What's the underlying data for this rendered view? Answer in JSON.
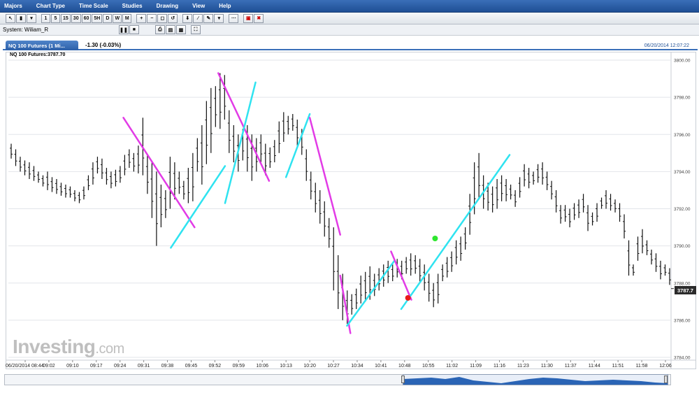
{
  "menu": [
    "Majors",
    "Chart Type",
    "Time Scale",
    "Studies",
    "Drawing",
    "View",
    "Help"
  ],
  "toolbar": {
    "intervals": [
      "1",
      "5",
      "15",
      "30",
      "60",
      "5H",
      "D",
      "W",
      "M"
    ]
  },
  "system": {
    "label": "System:",
    "value": "Wiliam_R"
  },
  "tab": {
    "label": "NQ 100 Futures (1 Mi...",
    "change": "-1.30 (-0.03%)",
    "datetime": "06/20/2014 12:07:22"
  },
  "chart_data": {
    "type": "ohlc-bar",
    "symbol_label": "NQ 100 Futures:3787.70",
    "last_price": "3787.7",
    "y_ticks": [
      "3800.00",
      "3798.00",
      "3796.00",
      "3794.00",
      "3792.00",
      "3790.00",
      "3788.00",
      "3786.00",
      "3784.00"
    ],
    "x_ticks": [
      "06/20/2014 08:44",
      "09:02",
      "09:10",
      "09:17",
      "09:24",
      "09:31",
      "09:38",
      "09:45",
      "09:52",
      "09:59",
      "10:06",
      "10:13",
      "10:20",
      "10:27",
      "10:34",
      "10:41",
      "10:48",
      "10:55",
      "11:02",
      "11:09",
      "11:16",
      "11:23",
      "11:30",
      "11:37",
      "11:44",
      "11:51",
      "11:58",
      "12:06"
    ],
    "ylim": [
      3784,
      3800
    ],
    "bars": [
      [
        3795.5,
        3794.7
      ],
      [
        3795.2,
        3794.3
      ],
      [
        3794.8,
        3794.0
      ],
      [
        3794.6,
        3793.8
      ],
      [
        3794.5,
        3793.6
      ],
      [
        3794.3,
        3793.5
      ],
      [
        3794.0,
        3793.4
      ],
      [
        3793.8,
        3793.2
      ],
      [
        3794.0,
        3793.0
      ],
      [
        3793.7,
        3792.9
      ],
      [
        3793.6,
        3792.8
      ],
      [
        3793.4,
        3792.7
      ],
      [
        3793.3,
        3792.6
      ],
      [
        3793.2,
        3792.6
      ],
      [
        3793.0,
        3792.4
      ],
      [
        3792.9,
        3792.3
      ],
      [
        3793.2,
        3792.5
      ],
      [
        3793.8,
        3793.0
      ],
      [
        3794.5,
        3793.3
      ],
      [
        3794.8,
        3793.9
      ],
      [
        3794.7,
        3793.6
      ],
      [
        3794.2,
        3793.3
      ],
      [
        3794.0,
        3793.1
      ],
      [
        3794.1,
        3793.2
      ],
      [
        3794.3,
        3793.4
      ],
      [
        3794.9,
        3793.8
      ],
      [
        3795.2,
        3794.2
      ],
      [
        3795.0,
        3794.0
      ],
      [
        3795.4,
        3793.9
      ],
      [
        3796.9,
        3793.8
      ],
      [
        3794.9,
        3792.8
      ],
      [
        3794.5,
        3791.5
      ],
      [
        3794.0,
        3790.0
      ],
      [
        3793.3,
        3791.0
      ],
      [
        3793.0,
        3791.5
      ],
      [
        3794.8,
        3792.0
      ],
      [
        3794.5,
        3792.5
      ],
      [
        3794.0,
        3792.8
      ],
      [
        3793.5,
        3792.5
      ],
      [
        3794.2,
        3792.3
      ],
      [
        3795.0,
        3792.4
      ],
      [
        3795.8,
        3794.0
      ],
      [
        3796.5,
        3793.3
      ],
      [
        3797.8,
        3794.4
      ],
      [
        3798.5,
        3795.0
      ],
      [
        3798.6,
        3796.4
      ],
      [
        3799.3,
        3796.3
      ],
      [
        3799.2,
        3796.8
      ],
      [
        3797.3,
        3795.0
      ],
      [
        3796.5,
        3794.5
      ],
      [
        3796.0,
        3794.0
      ],
      [
        3796.3,
        3794.6
      ],
      [
        3796.5,
        3794.0
      ],
      [
        3796.0,
        3793.5
      ],
      [
        3795.8,
        3794.0
      ],
      [
        3796.0,
        3794.5
      ],
      [
        3795.5,
        3793.8
      ],
      [
        3795.3,
        3794.2
      ],
      [
        3795.7,
        3794.5
      ],
      [
        3796.7,
        3795.0
      ],
      [
        3797.2,
        3795.6
      ],
      [
        3797.0,
        3796.0
      ],
      [
        3797.1,
        3796.2
      ],
      [
        3796.8,
        3795.4
      ],
      [
        3796.3,
        3794.9
      ],
      [
        3795.2,
        3793.5
      ],
      [
        3794.0,
        3792.5
      ],
      [
        3793.4,
        3791.8
      ],
      [
        3793.0,
        3791.2
      ],
      [
        3792.4,
        3790.5
      ],
      [
        3791.5,
        3789.9
      ],
      [
        3791.0,
        3787.6
      ],
      [
        3789.5,
        3786.6
      ],
      [
        3788.5,
        3786.0
      ],
      [
        3787.6,
        3785.8
      ],
      [
        3787.4,
        3786.3
      ],
      [
        3787.7,
        3786.6
      ],
      [
        3788.4,
        3786.9
      ],
      [
        3788.6,
        3787.0
      ],
      [
        3788.9,
        3787.1
      ],
      [
        3788.5,
        3787.3
      ],
      [
        3788.8,
        3787.6
      ],
      [
        3789.0,
        3787.8
      ],
      [
        3789.2,
        3788.0
      ],
      [
        3789.0,
        3788.1
      ],
      [
        3789.3,
        3788.3
      ],
      [
        3789.2,
        3788.2
      ],
      [
        3789.4,
        3788.5
      ],
      [
        3789.6,
        3788.4
      ],
      [
        3789.5,
        3788.5
      ],
      [
        3789.3,
        3788.0
      ],
      [
        3789.0,
        3787.6
      ],
      [
        3788.5,
        3787.0
      ],
      [
        3788.0,
        3786.7
      ],
      [
        3788.5,
        3786.9
      ],
      [
        3789.0,
        3788.1
      ],
      [
        3789.4,
        3788.3
      ],
      [
        3789.7,
        3788.6
      ],
      [
        3790.3,
        3789.0
      ],
      [
        3790.5,
        3789.2
      ],
      [
        3791.0,
        3789.8
      ],
      [
        3792.8,
        3790.6
      ],
      [
        3794.5,
        3791.7
      ],
      [
        3795.0,
        3792.5
      ],
      [
        3793.8,
        3792.0
      ],
      [
        3793.4,
        3791.9
      ],
      [
        3793.2,
        3791.8
      ],
      [
        3793.6,
        3792.0
      ],
      [
        3793.8,
        3792.4
      ],
      [
        3793.6,
        3792.4
      ],
      [
        3793.3,
        3792.5
      ],
      [
        3793.0,
        3792.1
      ],
      [
        3793.7,
        3792.6
      ],
      [
        3794.4,
        3793.2
      ],
      [
        3794.2,
        3793.1
      ],
      [
        3794.0,
        3793.3
      ],
      [
        3794.4,
        3793.4
      ],
      [
        3794.5,
        3793.3
      ],
      [
        3794.0,
        3793.0
      ],
      [
        3793.5,
        3792.5
      ],
      [
        3793.0,
        3791.8
      ],
      [
        3792.2,
        3791.2
      ],
      [
        3792.2,
        3791.3
      ],
      [
        3792.0,
        3791.0
      ],
      [
        3792.3,
        3791.4
      ],
      [
        3792.5,
        3791.5
      ],
      [
        3792.8,
        3791.8
      ],
      [
        3792.2,
        3790.8
      ],
      [
        3791.8,
        3791.1
      ],
      [
        3792.3,
        3791.3
      ],
      [
        3792.6,
        3792.0
      ],
      [
        3793.0,
        3792.0
      ],
      [
        3792.8,
        3791.9
      ],
      [
        3792.5,
        3791.8
      ],
      [
        3792.3,
        3791.3
      ],
      [
        3791.7,
        3790.4
      ],
      [
        3790.3,
        3788.4
      ],
      [
        3789.0,
        3788.4
      ],
      [
        3790.5,
        3789.2
      ],
      [
        3790.9,
        3789.6
      ],
      [
        3790.3,
        3789.5
      ],
      [
        3789.8,
        3789.0
      ],
      [
        3789.6,
        3788.6
      ],
      [
        3789.2,
        3788.2
      ],
      [
        3789.0,
        3788.4
      ],
      [
        3788.8,
        3787.9
      ]
    ],
    "trendlines": [
      {
        "color": "#e23be6",
        "from": [
          "09:24",
          3796.9
        ],
        "to": [
          "09:45",
          3791.0
        ]
      },
      {
        "color": "#2fe3f0",
        "from": [
          "09:38",
          3789.9
        ],
        "to": [
          "09:54",
          3794.3
        ]
      },
      {
        "color": "#e23be6",
        "from": [
          "09:52",
          3799.3
        ],
        "to": [
          "10:07",
          3793.5
        ]
      },
      {
        "color": "#2fe3f0",
        "from": [
          "09:54",
          3792.3
        ],
        "to": [
          "10:03",
          3798.8
        ]
      },
      {
        "color": "#2fe3f0",
        "from": [
          "10:12",
          3793.7
        ],
        "to": [
          "10:19",
          3797.1
        ]
      },
      {
        "color": "#e23be6",
        "from": [
          "10:19",
          3796.9
        ],
        "to": [
          "10:28",
          3790.6
        ]
      },
      {
        "color": "#e23be6",
        "from": [
          "10:28",
          3788.4
        ],
        "to": [
          "10:31",
          3785.3
        ]
      },
      {
        "color": "#2fe3f0",
        "from": [
          "10:30",
          3785.7
        ],
        "to": [
          "10:44",
          3789.2
        ]
      },
      {
        "color": "#e23be6",
        "from": [
          "10:43",
          3789.7
        ],
        "to": [
          "10:49",
          3787.1
        ]
      },
      {
        "color": "#2fe3f0",
        "from": [
          "10:46",
          3786.6
        ],
        "to": [
          "11:18",
          3794.9
        ]
      }
    ],
    "markers": [
      {
        "color": "#e81a1a",
        "x": "10:48",
        "y": 3787.2
      },
      {
        "color": "#2ee62e",
        "x": "10:56",
        "y": 3790.4
      }
    ],
    "grid": true
  },
  "logo": {
    "main": "Investing",
    "suffix": ".com"
  }
}
